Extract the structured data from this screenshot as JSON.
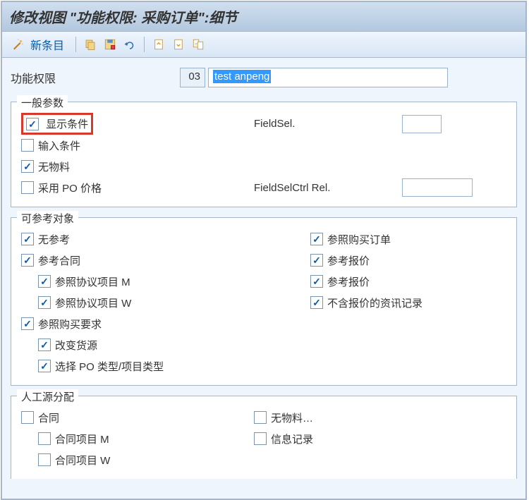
{
  "title": "修改视图 \"功能权限: 采购订单\":细节",
  "toolbar": {
    "new_entry": "新条目"
  },
  "main": {
    "label": "功能权限",
    "code": "03",
    "desc": "test anpeng"
  },
  "general": {
    "title": "一般参数",
    "display_conditions": "显示条件",
    "input_conditions": "输入条件",
    "no_material": "无物料",
    "adopt_po_price": "采用 PO 价格",
    "fieldsel": "FieldSel.",
    "fieldselctrl": "FieldSelCtrl Rel."
  },
  "ref": {
    "title": "可参考对象",
    "no_ref": "无参考",
    "ref_contract": "参考合同",
    "ref_agree_m": "参照协议项目 M",
    "ref_agree_w": "参照协议项目 W",
    "ref_pr": "参照购买要求",
    "change_src": "改变货源",
    "select_po_type": "选择 PO 类型/项目类型",
    "ref_po": "参照购买订单",
    "ref_quote1": "参考报价",
    "ref_quote2": "参考报价",
    "info_no_quote": "不含报价的资讯记录"
  },
  "manual": {
    "title": "人工源分配",
    "contract": "合同",
    "contract_m": "合同项目 M",
    "contract_w": "合同项目 W",
    "no_material": "无物料…",
    "info_record": "信息记录"
  }
}
